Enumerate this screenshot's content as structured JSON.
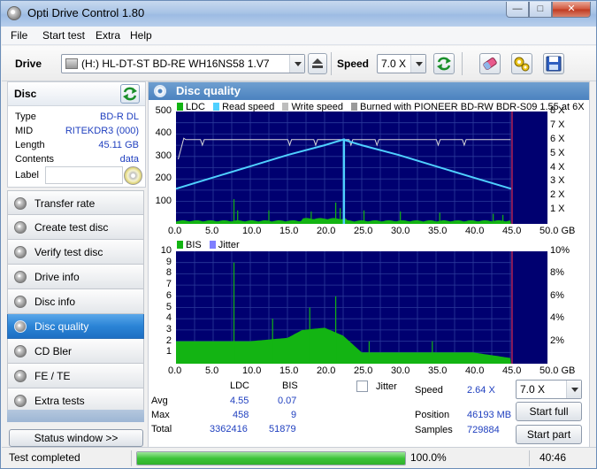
{
  "window": {
    "title": "Opti Drive Control 1.80",
    "min": "—",
    "max": "□",
    "close": "✕"
  },
  "menu": [
    "File",
    "Start test",
    "Extra",
    "Help"
  ],
  "toolbar": {
    "drive_label": "Drive",
    "drive_value": "(H:)   HL-DT-ST BD-RE  WH16NS58 1.V7",
    "speed_label": "Speed",
    "speed_value": "7.0 X"
  },
  "disc": {
    "header": "Disc",
    "fields": [
      {
        "label": "Type",
        "value": "BD-R DL"
      },
      {
        "label": "MID",
        "value": "RITEKDR3 (000)"
      },
      {
        "label": "Length",
        "value": "45.11 GB"
      },
      {
        "label": "Contents",
        "value": "data"
      }
    ],
    "label_label": "Label"
  },
  "nav": {
    "items": [
      "Transfer rate",
      "Create test disc",
      "Verify test disc",
      "Drive info",
      "Disc info",
      "Disc quality",
      "CD Bler",
      "FE / TE",
      "Extra tests"
    ],
    "active_index": 5,
    "status_button": "Status window >>"
  },
  "panel": {
    "title": "Disc quality"
  },
  "colors": {
    "plot_bg": "#000070",
    "ldc": "#13b413",
    "read_speed": "#4fd0ff",
    "write_speed": "#d8d8d8",
    "bis": "#13b413",
    "jitter": "#8080ff",
    "end_marker": "#8a1a5a"
  },
  "chart_data": [
    {
      "type": "area",
      "legend": [
        "LDC",
        "Read speed",
        "Write speed",
        "Burned with PIONEER BD-RW   BDR-S09 1.55 at 6X"
      ],
      "x_ticks": [
        "0.0",
        "5.0",
        "10.0",
        "15.0",
        "20.0",
        "25.0",
        "30.0",
        "35.0",
        "40.0",
        "45.0",
        "50.0 GB"
      ],
      "y_ticks": [
        "500",
        "400",
        "300",
        "200",
        "100"
      ],
      "y2_ticks": [
        "8 X",
        "7 X",
        "6 X",
        "5 X",
        "4 X",
        "3 X",
        "2 X",
        "1 X"
      ],
      "xlim": [
        0,
        50
      ],
      "ylim": [
        0,
        500
      ],
      "y2lim": [
        0,
        8
      ],
      "disc_end_gb": 45.11,
      "ldc_peaks": [
        {
          "x": 7.8,
          "y": 110
        },
        {
          "x": 8.3,
          "y": 60
        },
        {
          "x": 12.5,
          "y": 60
        },
        {
          "x": 18.2,
          "y": 55
        },
        {
          "x": 21.5,
          "y": 95
        },
        {
          "x": 22.1,
          "y": 70
        },
        {
          "x": 22.6,
          "y": 458
        },
        {
          "x": 25.3,
          "y": 60
        },
        {
          "x": 30.2,
          "y": 55
        },
        {
          "x": 35.5,
          "y": 50
        },
        {
          "x": 42.7,
          "y": 45
        },
        {
          "x": 44.0,
          "y": 40
        }
      ],
      "read_speed": {
        "x": [
          0,
          5,
          10,
          15,
          20,
          22.5,
          25,
          30,
          35,
          40,
          45.11
        ],
        "y": [
          2.5,
          3.3,
          4.1,
          4.9,
          5.6,
          6.0,
          5.6,
          4.9,
          4.1,
          3.3,
          2.5
        ]
      },
      "write_speed_approx_x": 6.0
    },
    {
      "type": "area",
      "legend": [
        "BIS",
        "Jitter"
      ],
      "x_ticks": [
        "0.0",
        "5.0",
        "10.0",
        "15.0",
        "20.0",
        "25.0",
        "30.0",
        "35.0",
        "40.0",
        "45.0",
        "50.0 GB"
      ],
      "y_ticks": [
        "10",
        "9",
        "8",
        "7",
        "6",
        "5",
        "4",
        "3",
        "2",
        "1"
      ],
      "y2_ticks": [
        "10%",
        "8%",
        "6%",
        "4%",
        "2%"
      ],
      "xlim": [
        0,
        50
      ],
      "ylim": [
        0,
        10
      ],
      "bis_profile": {
        "x": [
          0,
          5,
          10,
          15,
          17,
          20,
          22.5,
          25,
          30,
          35,
          40,
          45.11
        ],
        "y": [
          2,
          2,
          2,
          2.3,
          3,
          3.2,
          2.5,
          1,
          1,
          1,
          1,
          0.5
        ]
      },
      "bis_peaks": [
        {
          "x": 7.8,
          "y": 9
        },
        {
          "x": 13.0,
          "y": 4
        },
        {
          "x": 18.0,
          "y": 5
        },
        {
          "x": 21.5,
          "y": 6
        },
        {
          "x": 26.0,
          "y": 2
        },
        {
          "x": 34.5,
          "y": 2
        }
      ]
    }
  ],
  "stats": {
    "headers": [
      "LDC",
      "BIS"
    ],
    "rows": [
      {
        "label": "Avg",
        "ldc": "4.55",
        "bis": "0.07"
      },
      {
        "label": "Max",
        "ldc": "458",
        "bis": "9"
      },
      {
        "label": "Total",
        "ldc": "3362416",
        "bis": "51879"
      }
    ],
    "jitter_label": "Jitter",
    "speed_label": "Speed",
    "speed_value": "2.64 X",
    "speed_select": "7.0 X",
    "position_label": "Position",
    "position_value": "46193 MB",
    "samples_label": "Samples",
    "samples_value": "729884",
    "start_full": "Start full",
    "start_part": "Start part"
  },
  "statusbar": {
    "text": "Test completed",
    "progress_percent": 100,
    "progress_text": "100.0%",
    "time": "40:46"
  }
}
